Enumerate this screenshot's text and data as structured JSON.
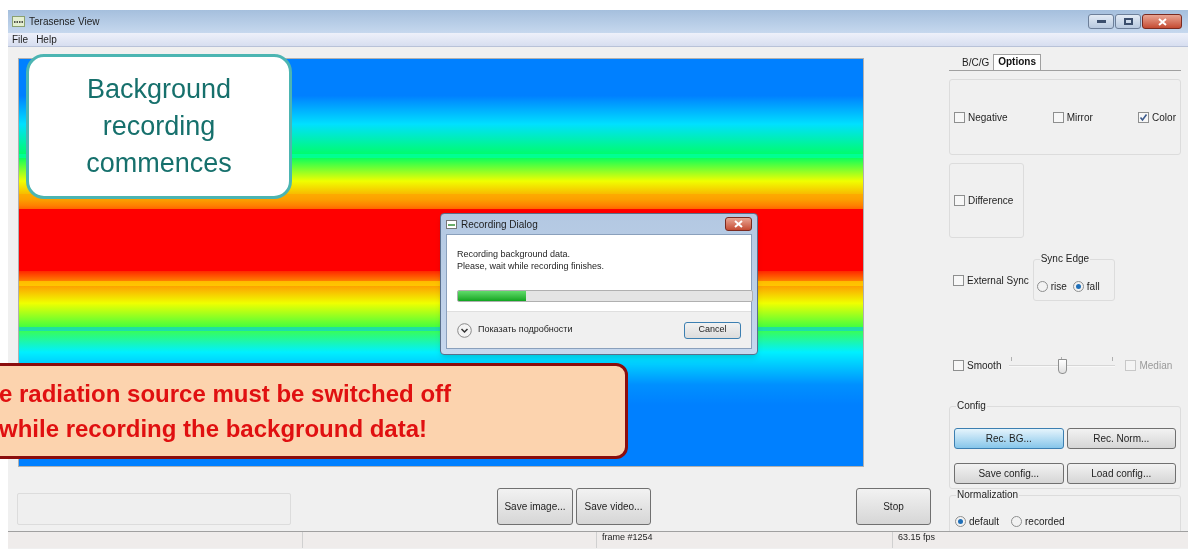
{
  "window": {
    "title": "Terasense View"
  },
  "menu": [
    "File",
    "Help"
  ],
  "callouts": [
    {
      "kind": "info",
      "text": "Background\nrecording\ncommences"
    },
    {
      "kind": "warning",
      "text": "e radiation source must be switched off\nwhile recording the background data!"
    }
  ],
  "dialog": {
    "title": "Recording Dialog",
    "message": "Recording background data.\nPlease, wait while recording finishes.",
    "progress": {
      "level": 0.23
    },
    "details": "Показать подробности",
    "button": "Cancel"
  },
  "bottom_buttons": [
    {
      "label": "Save image..."
    },
    {
      "label": "Save video..."
    },
    {
      "label": "Stop"
    }
  ],
  "status_bar": [
    "frame #1254",
    "63.15 fps"
  ],
  "tabs": [
    {
      "label": "B/C/G",
      "selected": false
    },
    {
      "label": "Options",
      "selected": true
    }
  ],
  "display_options": [
    {
      "label": "Negative",
      "checked": false
    },
    {
      "label": "Mirror",
      "checked": false
    },
    {
      "label": "Color",
      "checked": true
    }
  ],
  "difference": {
    "label": "Difference",
    "checked": false
  },
  "external_sync": {
    "label": "External Sync",
    "checked": false
  },
  "sync_edge": {
    "title": "Sync Edge",
    "options": [
      {
        "label": "rise",
        "selected": false
      },
      {
        "label": "fall",
        "selected": true
      }
    ]
  },
  "smooth": {
    "label": "Smooth",
    "checked": false,
    "slider": {
      "level": 0.5
    }
  },
  "median": {
    "label": "Median",
    "checked": false,
    "disabled": true
  },
  "config": {
    "title": "Config",
    "buttons": [
      {
        "label": "Rec. BG...",
        "highlighted": true
      },
      {
        "label": "Rec. Norm...",
        "highlighted": false
      },
      {
        "label": "Save config...",
        "highlighted": false
      },
      {
        "label": "Load config...",
        "highlighted": false
      }
    ]
  },
  "normalization": {
    "title": "Normalization",
    "options": [
      {
        "label": "default",
        "selected": true
      },
      {
        "label": "recorded",
        "selected": false
      }
    ]
  }
}
